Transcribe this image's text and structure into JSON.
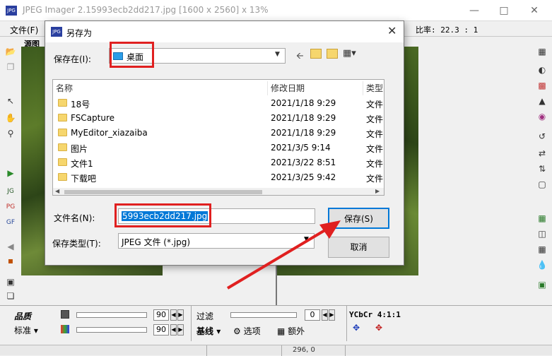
{
  "app": {
    "title": "JPEG Imager 2.15993ecb2dd217.jpg [1600 x 2560] x 13%",
    "menu_file": "文件(F)",
    "ratio": "比率: 22.3 : 1",
    "source_label": "源图"
  },
  "dialog": {
    "title": "另存为",
    "save_in_label": "保存在(I):",
    "save_in_value": "桌面",
    "columns": {
      "name": "名称",
      "date": "修改日期",
      "type": "类型"
    },
    "rows": [
      {
        "name": "18号",
        "date": "2021/1/18 9:29",
        "type": "文件"
      },
      {
        "name": "FSCapture",
        "date": "2021/1/18 9:29",
        "type": "文件"
      },
      {
        "name": "MyEditor_xiazaiba",
        "date": "2021/1/18 9:29",
        "type": "文件"
      },
      {
        "name": "图片",
        "date": "2021/3/5 9:14",
        "type": "文件"
      },
      {
        "name": "文件1",
        "date": "2021/3/22 8:51",
        "type": "文件"
      },
      {
        "name": "下载吧",
        "date": "2021/3/25 9:42",
        "type": "文件"
      }
    ],
    "filename_label": "文件名(N):",
    "filename_value": "5993ecb2dd217.jpg",
    "filetype_label": "保存类型(T):",
    "filetype_value": "JPEG 文件 (*.jpg)",
    "save_button": "保存(S)",
    "cancel_button": "取消"
  },
  "bottom": {
    "quality_label": "品质",
    "standard_label": "标准",
    "value1": "90",
    "value2": "90",
    "filter_label": "过滤",
    "filter_value": "0",
    "baseline_label": "基线",
    "options_label": "选项",
    "extra_label": "额外",
    "ycbcr_label": "YCbCr 4:1:1"
  },
  "status": {
    "coords": "296, 0"
  },
  "colors": {
    "accent": "#0078d7",
    "highlight_red": "#e02020"
  }
}
